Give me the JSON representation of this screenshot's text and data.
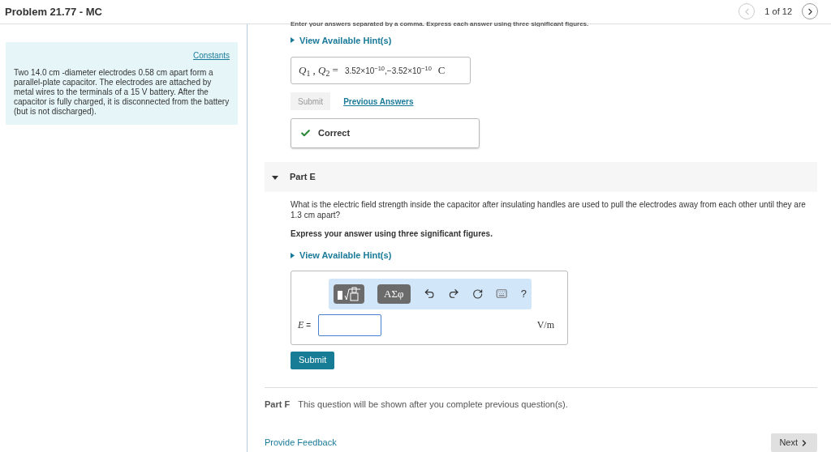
{
  "header": {
    "title": "Problem 21.77 - MC",
    "page": "1 of 12"
  },
  "sidebar": {
    "constants_link": "Constants",
    "problem_text": "Two 14.0 cm -diameter electrodes 0.58 cm apart form a parallel-plate capacitor. The electrodes are attached by metal wires to the terminals of a 15 V battery. After the capacitor is fully charged, it is disconnected from the battery (but is not discharged)."
  },
  "part_d": {
    "instruction": "Enter your answers separated by a comma. Express each answer using three significant figures.",
    "hint": "View Available Hint(s)",
    "answer_label": "*Q*$_{1}$ , *Q*$_{2}$ =",
    "answer_value": "3.52×10$^{−10}$,−3.52×10$^{−10}$",
    "answer_unit": "C",
    "submit": {
      "label": "Submit",
      "disabled": true
    },
    "previous_answers": "Previous Answers",
    "feedback": {
      "label": "Correct",
      "correct": true
    }
  },
  "part_e": {
    "title": "Part E",
    "expanded": true,
    "question": "What is the electric field strength inside the capacitor after insulating handles are used to pull the electrodes away from each other until they are 1.3 cm apart?",
    "instruction": "Express your answer using three significant figures.",
    "hint": "View Available Hint(s)",
    "toolbar": [
      {
        "kind": "templates"
      },
      {
        "kind": "text",
        "label": "ΑΣφ"
      },
      {
        "kind": "undo"
      },
      {
        "kind": "redo"
      },
      {
        "kind": "reset"
      },
      {
        "kind": "keyboard"
      },
      {
        "kind": "plain",
        "label": "?"
      }
    ],
    "variable": "*E*",
    "equals": "=",
    "unit": "V/m",
    "submit": {
      "label": "Submit",
      "disabled": false
    }
  },
  "part_f": {
    "title": "Part F",
    "text": "This question will be shown after you complete previous question(s)."
  },
  "footer": {
    "feedback_link": "Provide Feedback",
    "next": "Next"
  }
}
